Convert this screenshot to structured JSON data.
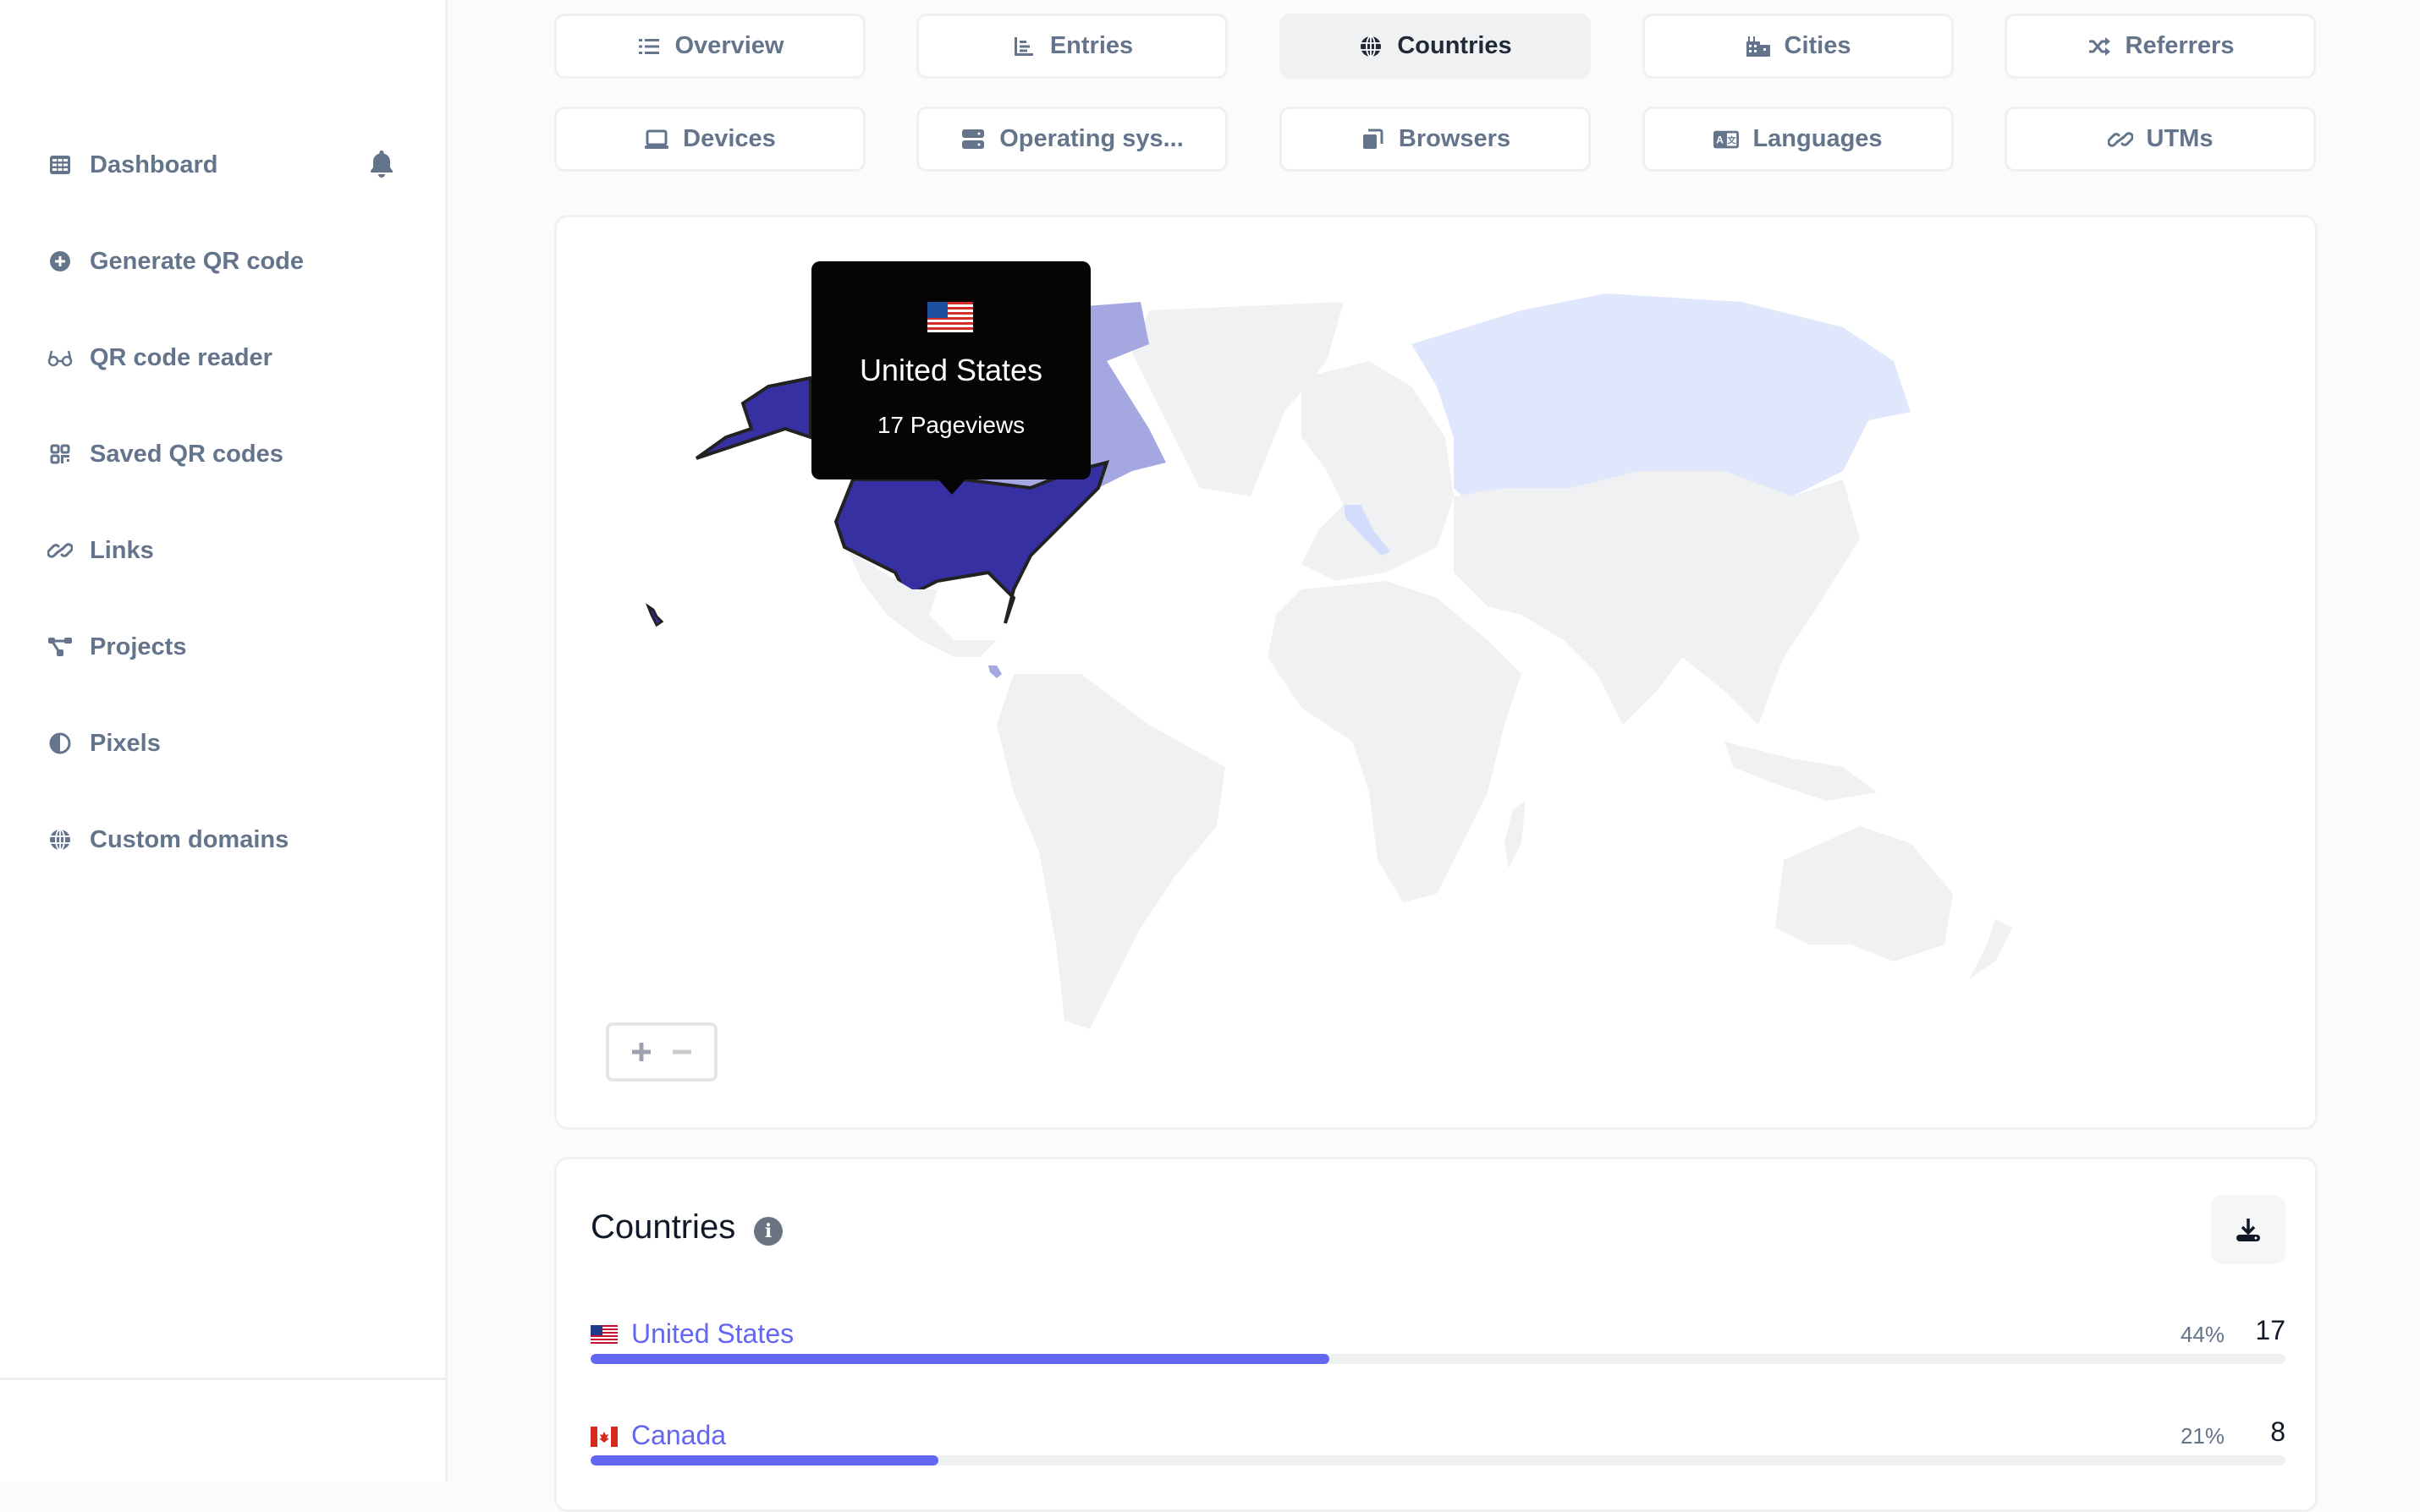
{
  "sidebar": {
    "items": [
      {
        "label": "Dashboard",
        "icon": "table-cells-icon"
      },
      {
        "label": "Generate QR code",
        "icon": "plus-circle-icon"
      },
      {
        "label": "QR code reader",
        "icon": "glasses-icon"
      },
      {
        "label": "Saved QR codes",
        "icon": "qrcode-icon"
      },
      {
        "label": "Links",
        "icon": "link-icon"
      },
      {
        "label": "Projects",
        "icon": "diagram-project-icon"
      },
      {
        "label": "Pixels",
        "icon": "adjust-icon"
      },
      {
        "label": "Custom domains",
        "icon": "globe-icon"
      }
    ],
    "notification_icon": "bell-icon"
  },
  "tabs": [
    {
      "label": "Overview",
      "icon": "list-icon",
      "active": false
    },
    {
      "label": "Entries",
      "icon": "chart-bar-icon",
      "active": false
    },
    {
      "label": "Countries",
      "icon": "globe-icon",
      "active": true
    },
    {
      "label": "Cities",
      "icon": "city-icon",
      "active": false
    },
    {
      "label": "Referrers",
      "icon": "random-icon",
      "active": false
    },
    {
      "label": "Devices",
      "icon": "laptop-icon",
      "active": false
    },
    {
      "label": "Operating sys...",
      "icon": "server-icon",
      "active": false
    },
    {
      "label": "Browsers",
      "icon": "window-restore-icon",
      "active": false
    },
    {
      "label": "Languages",
      "icon": "language-icon",
      "active": false
    },
    {
      "label": "UTMs",
      "icon": "link-icon",
      "active": false
    }
  ],
  "map": {
    "tooltip": {
      "flag": "🇺🇸",
      "country": "United States",
      "views": "17 Pageviews"
    },
    "zoom_in_label": "+",
    "zoom_out_label": "−",
    "highlighted_countries": [
      {
        "name": "United States",
        "level": "high",
        "color": "#3730a3"
      },
      {
        "name": "Canada",
        "level": "medium",
        "color": "#a5a7e0"
      },
      {
        "name": "Costa Rica",
        "level": "medium",
        "color": "#a5a7e0"
      },
      {
        "name": "Russia",
        "level": "low",
        "color": "#e0e7fd"
      },
      {
        "name": "Italy",
        "level": "low",
        "color": "#d3dcfb"
      },
      {
        "name": "Belize",
        "level": "low",
        "color": "#e0e7fd"
      }
    ],
    "default_land_color": "#f0f1f3"
  },
  "countries_list": {
    "title": "Countries",
    "info_icon": "info-circle-icon",
    "download_icon": "download-icon",
    "rows": [
      {
        "flag": "US",
        "name": "United States",
        "percent": "44%",
        "count": "17",
        "share": 0.436
      },
      {
        "flag": "CA",
        "name": "Canada",
        "percent": "21%",
        "count": "8",
        "share": 0.205
      }
    ]
  },
  "colors": {
    "accent": "#6366f1",
    "text_muted": "#64748b",
    "tooltip_bg": "#050505"
  }
}
